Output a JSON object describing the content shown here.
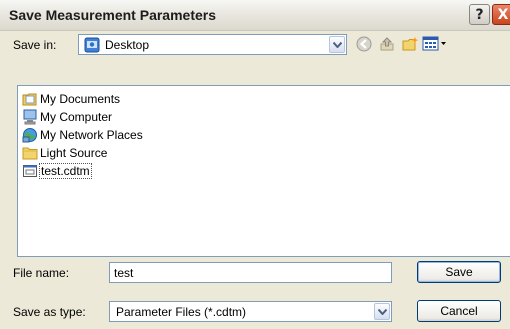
{
  "dialog": {
    "title": "Save Measurement Parameters",
    "help_glyph": "?",
    "close_glyph": "X"
  },
  "save_in": {
    "label": "Save in:",
    "value": "Desktop",
    "value_icon": "desktop-icon"
  },
  "toolbar": {
    "items": [
      {
        "icon": "back-arrow-icon"
      },
      {
        "icon": "up-folder-icon"
      },
      {
        "icon": "new-folder-icon"
      },
      {
        "icon": "view-menu-icon"
      }
    ]
  },
  "files": [
    {
      "name": "My Documents",
      "icon": "my-documents-icon"
    },
    {
      "name": "My Computer",
      "icon": "my-computer-icon"
    },
    {
      "name": "My Network Places",
      "icon": "network-places-icon"
    },
    {
      "name": "Light Source",
      "icon": "folder-icon"
    },
    {
      "name": "test.cdtm",
      "icon": "file-icon",
      "selected": true
    }
  ],
  "file_name": {
    "label": "File name:",
    "value": "test"
  },
  "save_as_type": {
    "label": "Save as type:",
    "value": "Parameter Files (*.cdtm)"
  },
  "buttons": {
    "save": "Save",
    "cancel": "Cancel"
  },
  "colors": {
    "dialog_bg": "#ece9d8",
    "field_border": "#7f9db9",
    "close_button": "#c9441e"
  }
}
